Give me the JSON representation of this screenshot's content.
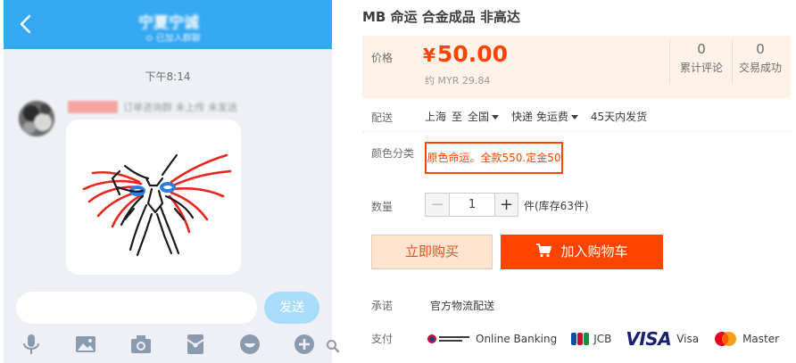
{
  "chat": {
    "header_title": "宁夏宁诚",
    "header_subtitle": "⊙ 已加入群聊",
    "timestamp": "下午8:14",
    "sender_name": "订单咨询群 未上传 未发送",
    "send_label": "发送",
    "toolbar_icons": [
      "microphone-icon",
      "image-icon",
      "camera-icon",
      "red-packet-icon",
      "emoji-icon",
      "plus-icon"
    ],
    "colors": {
      "header": "#35a8f2",
      "background": "#eef0f5",
      "send": "#a9dcfb"
    }
  },
  "product": {
    "title": "MB 命运 合金成品 非高达",
    "price_label": "价格",
    "price_currency": "¥",
    "price_value": "50.00",
    "price_converted": "约 MYR 29.84",
    "stats": [
      {
        "value": "0",
        "label": "累计评论"
      },
      {
        "value": "0",
        "label": "交易成功"
      }
    ],
    "delivery": {
      "label": "配送",
      "from": "上海",
      "to_word": "至",
      "to": "全国",
      "method": "快递 免运费",
      "ship_time": "45天内发货"
    },
    "color_label": "颜色分类",
    "color_option": "原色命运。全款550.定金50",
    "quantity": {
      "label": "数量",
      "minus": "−",
      "value": "1",
      "plus": "+",
      "stock": "件(库存63件)"
    },
    "buy_now_label": "立即购买",
    "add_cart_label": "加入购物车",
    "promise_label": "承诺",
    "promise_text": "官方物流配送",
    "pay_label": "支付",
    "payments": [
      {
        "icon": "online-banking-icon",
        "label": "Online Banking"
      },
      {
        "icon": "jcb-icon",
        "label": "JCB"
      },
      {
        "icon": "visa-logo",
        "logo_text": "VISA",
        "label": "Visa"
      },
      {
        "icon": "mastercard-icon",
        "label": "Master"
      }
    ],
    "colors": {
      "accent": "#ff4400",
      "price_bg": "#fff2e8",
      "buy_now_bg": "#ffe4d0"
    }
  }
}
